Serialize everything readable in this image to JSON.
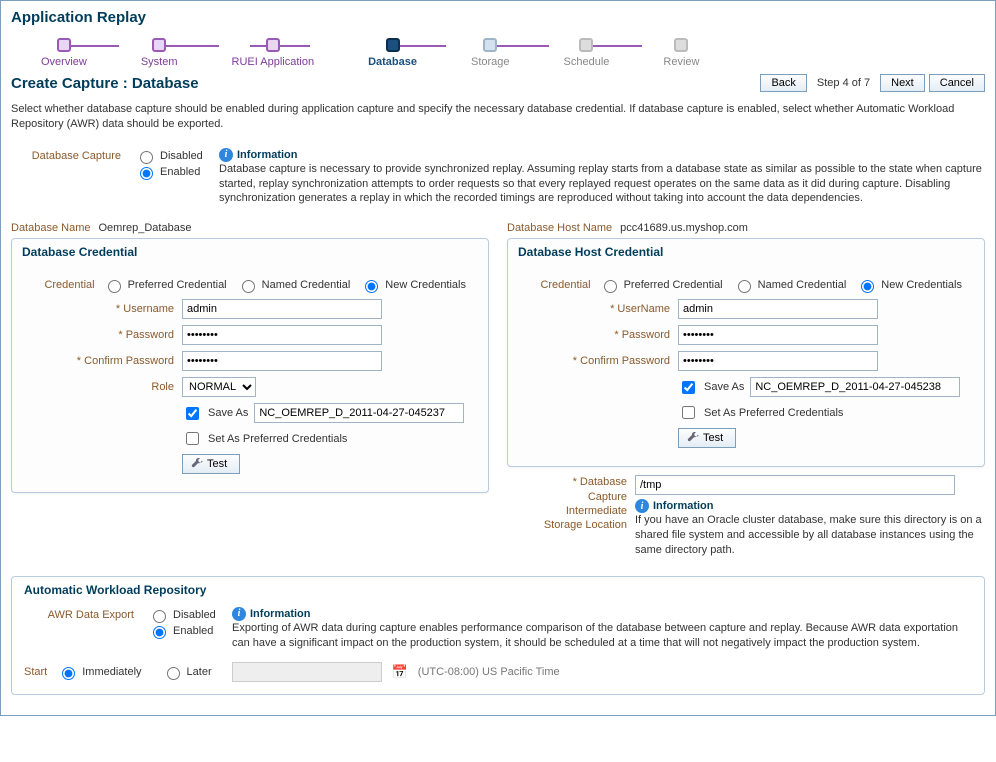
{
  "app_title": "Application Replay",
  "train": [
    {
      "label": "Overview",
      "state": "done"
    },
    {
      "label": "System",
      "state": "done"
    },
    {
      "label": "RUEI Application",
      "state": "done"
    },
    {
      "label": "Database",
      "state": "current"
    },
    {
      "label": "Storage",
      "state": "future"
    },
    {
      "label": "Schedule",
      "state": "disabled"
    },
    {
      "label": "Review",
      "state": "disabled"
    }
  ],
  "page_heading": "Create Capture : Database",
  "buttons": {
    "back": "Back",
    "next": "Next",
    "cancel": "Cancel"
  },
  "step_indicator": "Step 4 of 7",
  "intro": "Select whether database capture should be enabled during application capture and specify the necessary database credential. If database capture is enabled, select whether Automatic Workload Repository (AWR) data should be exported.",
  "db_capture": {
    "label": "Database Capture",
    "options": {
      "disabled": "Disabled",
      "enabled": "Enabled"
    },
    "selected": "enabled",
    "info_title": "Information",
    "info_body": "Database capture is necessary to provide synchronized replay. Assuming replay starts from a database state as similar as possible to the state when capture started, replay synchronization attempts to order requests so that every replayed request operates on the same data as it did during capture. Disabling synchronization generates a replay in which the recorded timings are reproduced without taking into account the data dependencies."
  },
  "db_name": {
    "label": "Database Name",
    "value": "Oemrep_Database"
  },
  "db_host": {
    "label": "Database Host Name",
    "value": "pcc41689.us.myshop.com"
  },
  "db_cred": {
    "panel_title": "Database Credential",
    "credential_label": "Credential",
    "cred_options": {
      "preferred": "Preferred Credential",
      "named": "Named Credential",
      "new": "New Credentials"
    },
    "cred_selected": "new",
    "username_label": "Username",
    "username": "admin",
    "password_label": "Password",
    "password": "••••••••",
    "confirm_label": "Confirm Password",
    "confirm": "••••••••",
    "role_label": "Role",
    "role": "NORMAL",
    "save_as_label": "Save As",
    "save_as_checked": true,
    "save_as_value": "NC_OEMREP_D_2011-04-27-045237",
    "set_preferred_label": "Set As Preferred Credentials",
    "set_preferred_checked": false,
    "test_label": "Test"
  },
  "host_cred": {
    "panel_title": "Database Host Credential",
    "credential_label": "Credential",
    "cred_options": {
      "preferred": "Preferred Credential",
      "named": "Named Credential",
      "new": "New Credentials"
    },
    "cred_selected": "new",
    "username_label": "UserName",
    "username": "admin",
    "password_label": "Password",
    "password": "••••••••",
    "confirm_label": "Confirm Password",
    "confirm": "••••••••",
    "save_as_label": "Save As",
    "save_as_checked": true,
    "save_as_value": "NC_OEMREP_D_2011-04-27-045238",
    "set_preferred_label": "Set As Preferred Credentials",
    "set_preferred_checked": false,
    "test_label": "Test"
  },
  "storage": {
    "label_l1": "Database",
    "label_l2": "Capture",
    "label_l3": "Intermediate",
    "label_l4": "Storage Location",
    "value": "/tmp",
    "info_title": "Information",
    "info_body": "If you have an Oracle cluster database, make sure this directory is on a shared file system and accessible by all database instances using the same directory path."
  },
  "awr": {
    "panel_title": "Automatic Workload Repository",
    "export_label": "AWR Data Export",
    "options": {
      "disabled": "Disabled",
      "enabled": "Enabled"
    },
    "selected": "enabled",
    "info_title": "Information",
    "info_body": "Exporting of AWR data during capture enables performance comparison of the database between capture and replay. Because AWR data exportation can have a significant impact on the production system, it should be scheduled at a time that will not negatively impact the production system.",
    "start_label": "Start",
    "start_options": {
      "immediately": "Immediately",
      "later": "Later"
    },
    "start_selected": "immediately",
    "tz": "(UTC-08:00) US Pacific Time"
  }
}
